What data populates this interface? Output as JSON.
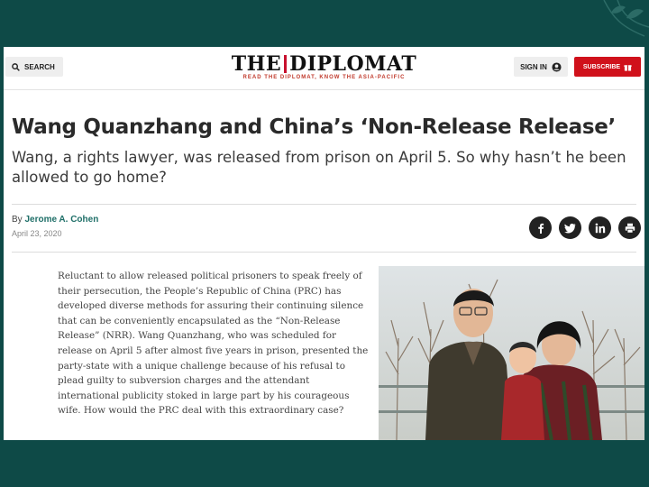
{
  "site": {
    "search_label": "SEARCH",
    "brand_left": "THE",
    "brand_right": "DIPLOMAT",
    "tagline": "READ THE DIPLOMAT, KNOW THE ASIA-PACIFIC",
    "signin_label": "SIGN IN",
    "subscribe_label": "SUBSCRIBE"
  },
  "article": {
    "headline": "Wang Quanzhang and China’s ‘Non-Release Release’",
    "subheadline": "Wang, a rights lawyer, was released from prison on April 5. So why hasn’t he been allowed to go home?",
    "byline_prefix": "By",
    "author": "Jerome A. Cohen",
    "date": "April 23, 2020",
    "body": "Reluctant to allow released political prisoners to speak freely of their persecution, the People’s Republic of China (PRC) has developed diverse methods for assuring their continuing silence that can be conveniently encapsulated as the “Non-Release Release” (NRR). Wang Quanzhang, who was scheduled for release on April 5 after almost five years in prison, presented the party-state with a unique challenge because of his refusal to plead guilty to subversion charges and the attendant international publicity stoked in large part by his courageous wife. How would the PRC deal with this extraordinary case?"
  },
  "share_icons": [
    "facebook-icon",
    "twitter-icon",
    "linkedin-icon",
    "print-icon"
  ],
  "colors": {
    "background": "#0e4a47",
    "brand_red": "#d0111b",
    "author_link": "#1f6f68"
  }
}
